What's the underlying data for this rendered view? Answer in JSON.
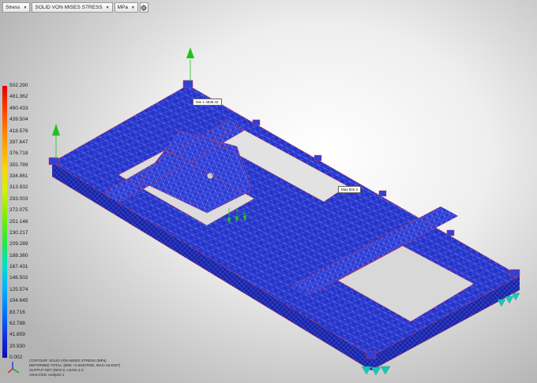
{
  "toolbar": {
    "result_type": "Stress",
    "result_component": "SOLID VON MISES STRESS",
    "units": "MPa"
  },
  "legend": {
    "values": [
      "502.290",
      "481.362",
      "460.433",
      "439.504",
      "418.576",
      "397.647",
      "376.718",
      "355.789",
      "334.861",
      "313.932",
      "293.003",
      "272.075",
      "251.146",
      "230.217",
      "209.289",
      "188.360",
      "167.431",
      "146.502",
      "125.574",
      "104.645",
      "83.716",
      "62.788",
      "41.859",
      "20.930",
      "0.002"
    ]
  },
  "info": {
    "contour": "CONTOUR: SOLID VON MISES STRESS (MPa)",
    "deformed": "DEFORMED TOTAL: [MIN: +0.0040702E, MAX+16.8197]",
    "output_set": "OUTPUT SET: [NCS 8, LOAD=1.0",
    "analysis": "ANALYSIS: Analysis 1"
  },
  "callouts": {
    "min": "Min 1 3838.42",
    "max": "Max 502.3"
  },
  "colors": {
    "mesh_blue": "#2433c8",
    "edge_red": "#e03040",
    "load_arrow": "#20c020",
    "constraint": "#18c8b8"
  }
}
